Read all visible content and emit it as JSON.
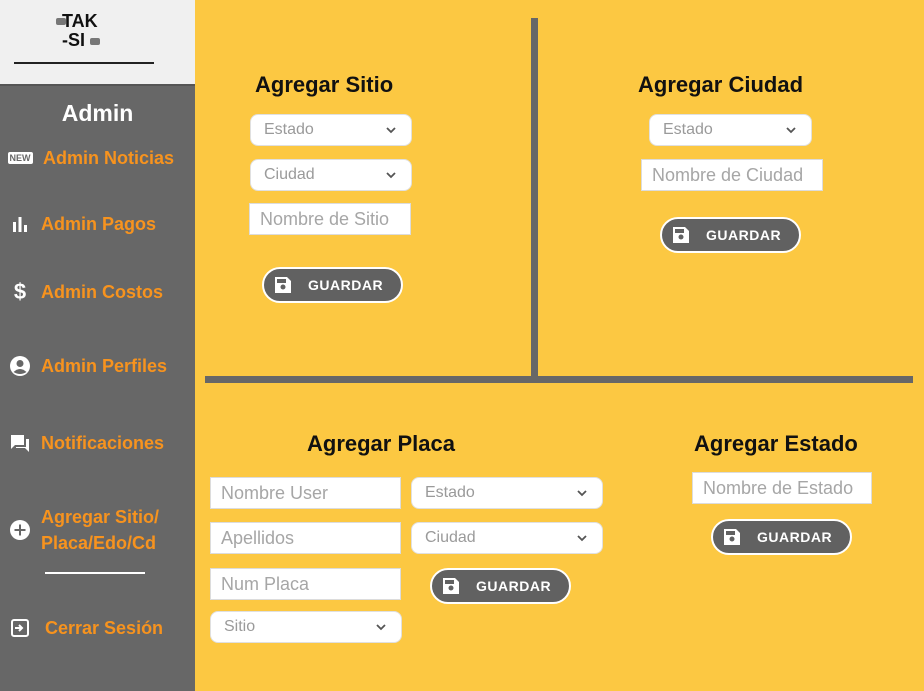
{
  "logo": {
    "line1": "TAK",
    "line2": "-SI"
  },
  "sidebar": {
    "title": "Admin",
    "items": [
      {
        "label": "Admin Noticias",
        "icon": "new-badge-icon"
      },
      {
        "label": "Admin Pagos",
        "icon": "bar-chart-icon"
      },
      {
        "label": "Admin Costos",
        "icon": "dollar-icon"
      },
      {
        "label": "Admin Perfiles",
        "icon": "account-circle-icon"
      },
      {
        "label": "Notificaciones",
        "icon": "forum-icon"
      },
      {
        "label_line1": "Agregar Sitio/",
        "label_line2": "Placa/Edo/Cd",
        "icon": "add-circle-icon"
      },
      {
        "label": "Cerrar Sesión",
        "icon": "logout-icon"
      }
    ],
    "new_badge_text": "NEW"
  },
  "sitio": {
    "title": "Agregar Sitio",
    "estado_select": "Estado",
    "ciudad_select": "Ciudad",
    "nombre_placeholder": "Nombre de Sitio",
    "save_label": "GUARDAR"
  },
  "ciudad": {
    "title": "Agregar Ciudad",
    "estado_select": "Estado",
    "nombre_placeholder": "Nombre de Ciudad",
    "save_label": "GUARDAR"
  },
  "placa": {
    "title": "Agregar Placa",
    "nombre_user_placeholder": "Nombre User",
    "apellidos_placeholder": "Apellidos",
    "num_placa_placeholder": "Num Placa",
    "sitio_select": "Sitio",
    "estado_select": "Estado",
    "ciudad_select": "Ciudad",
    "save_label": "GUARDAR"
  },
  "estado": {
    "title": "Agregar Estado",
    "nombre_placeholder": "Nombre de Estado",
    "save_label": "GUARDAR"
  },
  "colors": {
    "sidebar_bg": "#676767",
    "main_bg": "#fcc842",
    "accent_orange": "#f7931e",
    "button_bg": "#616161"
  }
}
